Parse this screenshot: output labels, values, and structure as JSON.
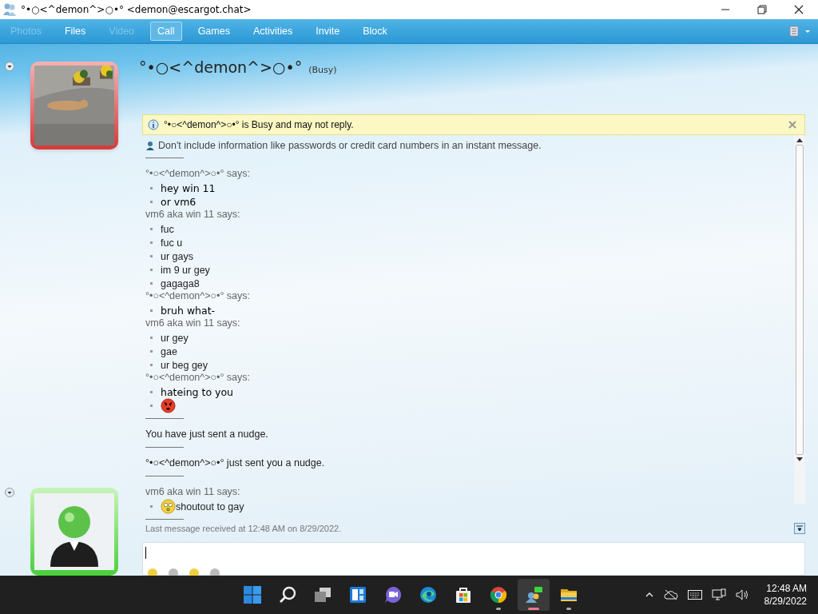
{
  "window": {
    "title": "°•○<^demon^>○•° <demon@escargot.chat>"
  },
  "menu": [
    {
      "label": "Photos",
      "disabled": true,
      "highlighted": false
    },
    {
      "label": "Files",
      "disabled": false,
      "highlighted": false
    },
    {
      "label": "Video",
      "disabled": true,
      "highlighted": false
    },
    {
      "label": "Call",
      "disabled": false,
      "highlighted": true
    },
    {
      "label": "Games",
      "disabled": false,
      "highlighted": false
    },
    {
      "label": "Activities",
      "disabled": false,
      "highlighted": false
    },
    {
      "label": "Invite",
      "disabled": false,
      "highlighted": false
    },
    {
      "label": "Block",
      "disabled": false,
      "highlighted": false
    }
  ],
  "contact": {
    "name": "°•○<^demon^>○•°",
    "status": "(Busy)"
  },
  "info_bar": {
    "text": "°•○<^demon^>○•° is Busy and may not reply."
  },
  "conversation": [
    {
      "kind": "warning",
      "text": "Don't include information like passwords or credit card numbers in an instant message."
    },
    {
      "kind": "divider"
    },
    {
      "kind": "message",
      "sender": "°•○<^demon^>○•° says:",
      "emphasis": true,
      "lines": [
        {
          "kind": "text",
          "text": "hey win 11"
        },
        {
          "kind": "text",
          "text": "or vm6"
        }
      ]
    },
    {
      "kind": "message",
      "sender": "vm6 aka win 11 says:",
      "emphasis": false,
      "lines": [
        {
          "kind": "text",
          "text": "fuc"
        },
        {
          "kind": "text",
          "text": "fuc u"
        },
        {
          "kind": "text",
          "text": "ur gays"
        },
        {
          "kind": "text",
          "text": "im 9 ur gey"
        },
        {
          "kind": "text",
          "text": "gagaga8"
        }
      ]
    },
    {
      "kind": "message",
      "sender": "°•○<^demon^>○•° says:",
      "emphasis": true,
      "lines": [
        {
          "kind": "text",
          "text": "bruh what-"
        }
      ]
    },
    {
      "kind": "message",
      "sender": "vm6 aka win 11 says:",
      "emphasis": false,
      "lines": [
        {
          "kind": "text",
          "text": "ur gey"
        },
        {
          "kind": "text",
          "text": "gae"
        },
        {
          "kind": "text",
          "text": "ur beg gey"
        }
      ]
    },
    {
      "kind": "message",
      "sender": "°•○<^demon^>○•° says:",
      "emphasis": true,
      "lines": [
        {
          "kind": "text",
          "text": "hateing to you"
        },
        {
          "kind": "angry_emoticon"
        }
      ]
    },
    {
      "kind": "divider"
    },
    {
      "kind": "notice",
      "text": "You have just sent a nudge."
    },
    {
      "kind": "divider"
    },
    {
      "kind": "notice",
      "text": "°•○<^demon^>○•° just sent you a nudge."
    },
    {
      "kind": "divider"
    },
    {
      "kind": "message",
      "sender": "vm6 aka win 11 says:",
      "emphasis": false,
      "lines": [
        {
          "kind": "confused_emoticon_text",
          "text": "shoutout to gay"
        }
      ]
    },
    {
      "kind": "divider"
    }
  ],
  "last_message": "Last message received at 12:48 AM on 8/29/2022.",
  "taskbar": {
    "apps": [
      {
        "kind": "start",
        "running": false,
        "active": false
      },
      {
        "kind": "search",
        "running": false,
        "active": false
      },
      {
        "kind": "taskview",
        "running": false,
        "active": false
      },
      {
        "kind": "widgets",
        "running": false,
        "active": false
      },
      {
        "kind": "chat",
        "running": false,
        "active": false
      },
      {
        "kind": "edge",
        "running": false,
        "active": false
      },
      {
        "kind": "store",
        "running": false,
        "active": false
      },
      {
        "kind": "chrome",
        "running": true,
        "active": false
      },
      {
        "kind": "messenger",
        "running": true,
        "active": true
      },
      {
        "kind": "explorer",
        "running": true,
        "active": false
      }
    ],
    "time": "12:48 AM",
    "date": "8/29/2022"
  }
}
